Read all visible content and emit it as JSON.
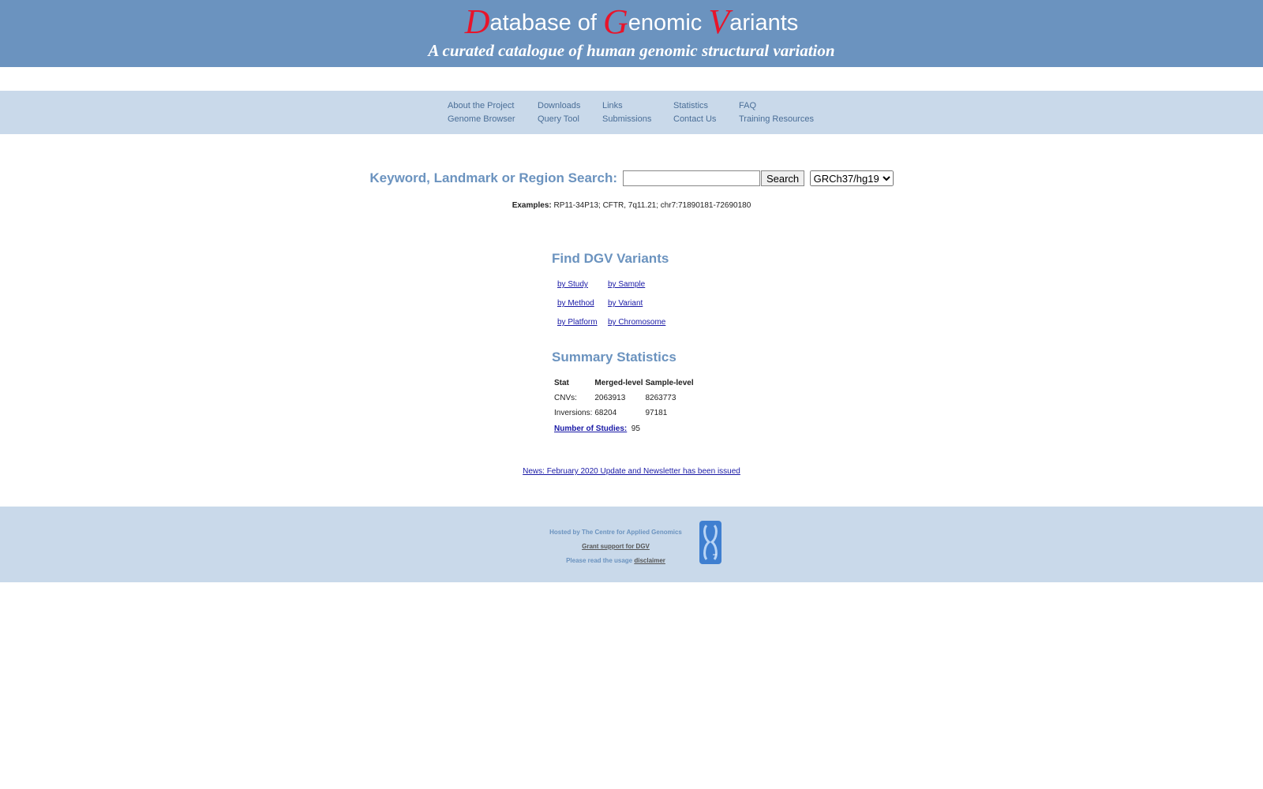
{
  "header": {
    "title_parts": [
      {
        "cap": "D",
        "rest": "atabase of "
      },
      {
        "cap": "G",
        "rest": "enomic "
      },
      {
        "cap": "V",
        "rest": "ariants"
      }
    ],
    "subtitle": "A curated catalogue of human genomic structural variation"
  },
  "nav": {
    "items": [
      "About the Project",
      "Downloads",
      "Links",
      "Statistics",
      "FAQ",
      "Genome Browser",
      "Query Tool",
      "Submissions",
      "Contact Us",
      "Training Resources"
    ]
  },
  "search": {
    "label": "Keyword, Landmark or Region Search:",
    "value": "",
    "button": "Search",
    "assembly": "GRCh37/hg19"
  },
  "examples": {
    "label": "Examples:",
    "text": "RP11-34P13; CFTR, 7q11.21; chr7:71890181-72690180"
  },
  "find": {
    "heading": "Find DGV Variants",
    "links": [
      "by Study",
      "by Sample",
      "by Method",
      "by Variant",
      "by Platform",
      "by Chromosome"
    ]
  },
  "summary": {
    "heading": "Summary Statistics",
    "headers": [
      "Stat",
      "Merged-level",
      "Sample-level"
    ],
    "rows": [
      [
        "CNVs:",
        "2063913",
        "8263773"
      ],
      [
        "Inversions:",
        "68204",
        "97181"
      ]
    ],
    "studies_label": "Number of Studies:",
    "studies_value": "95"
  },
  "news": {
    "text": "News: February 2020 Update and Newsletter has been issued"
  },
  "footer": {
    "hosted": "Hosted by The Centre for Applied Genomics",
    "grant": "Grant support for DGV",
    "usage_prefix": "Please read the usage",
    "disclaimer": "disclaimer"
  }
}
